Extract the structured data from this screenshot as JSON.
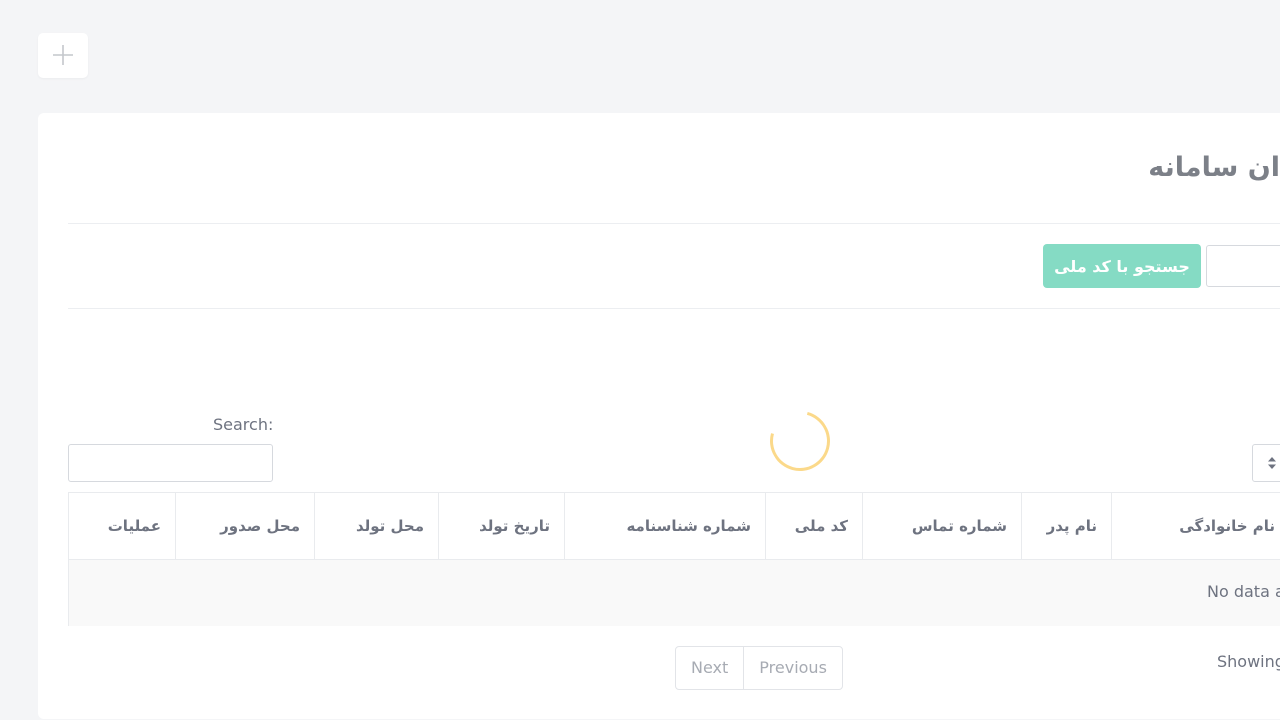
{
  "header": {
    "add_icon": "plus-icon"
  },
  "card": {
    "title": "ان سامانه"
  },
  "national_code_search": {
    "input_value": "",
    "button_label": "جستجو با کد ملی"
  },
  "loading": {
    "spinner_color": "#fbd98a"
  },
  "table_controls": {
    "search_label": "Search:",
    "search_value": "",
    "length_icon": "sort-arrows-icon"
  },
  "table": {
    "columns": [
      "عملیات",
      "محل صدور",
      "محل تولد",
      "تاریخ تولد",
      "شماره شناسنامه",
      "کد ملی",
      "شماره تماس",
      "نام پدر",
      "نام خانوادگی"
    ],
    "empty_message": "No data a"
  },
  "pagination": {
    "next_label": "Next",
    "previous_label": "Previous"
  },
  "info": {
    "text": "Showing"
  },
  "colors": {
    "page_bg": "#f4f5f7",
    "card_bg": "#ffffff",
    "accent_button": "#85dbc4",
    "spinner": "#fbd98a",
    "text": "#6e7380",
    "muted": "#a7abb3"
  }
}
